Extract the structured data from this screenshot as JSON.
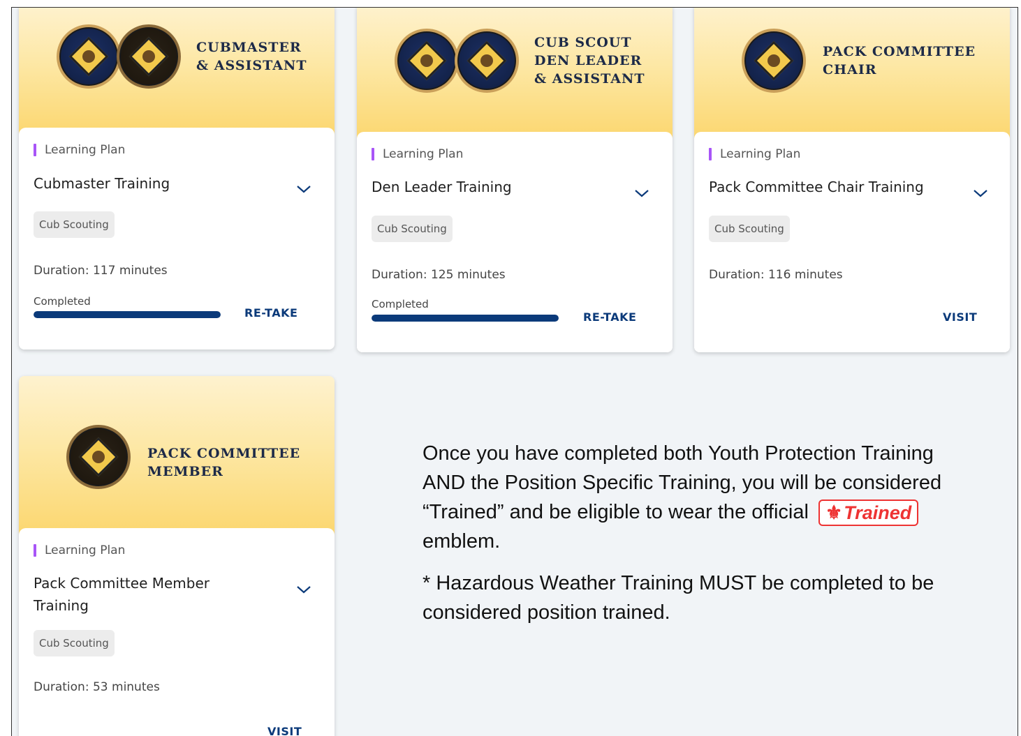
{
  "cards": [
    {
      "banner_line1": "CUBMASTER",
      "banner_line2": "& ASSISTANT",
      "banner_line3": "",
      "badge_icons": [
        "cubmaster-patch-icon",
        "assistant-cubmaster-patch-icon"
      ],
      "label": "Learning Plan",
      "title_line1": "Cubmaster Training",
      "title_line2": "",
      "tag": "Cub Scouting",
      "duration": "Duration: 117 minutes",
      "status": "Completed",
      "progress_percent": 100,
      "action": "RE-TAKE"
    },
    {
      "banner_line1": "CUB SCOUT",
      "banner_line2": "DEN LEADER",
      "banner_line3": "& ASSISTANT",
      "badge_icons": [
        "den-leader-patch-icon",
        "assistant-den-leader-patch-icon"
      ],
      "label": "Learning Plan",
      "title_line1": "Den Leader Training",
      "title_line2": "",
      "tag": "Cub Scouting",
      "duration": "Duration: 125 minutes",
      "status": "Completed",
      "progress_percent": 100,
      "action": "RE-TAKE"
    },
    {
      "banner_line1": "PACK COMMITTEE",
      "banner_line2": "CHAIR",
      "banner_line3": "",
      "badge_icons": [
        "pack-committee-chairman-patch-icon"
      ],
      "label": "Learning Plan",
      "title_line1": "Pack Committee Chair Training",
      "title_line2": "",
      "tag": "Cub Scouting",
      "duration": "Duration: 116 minutes",
      "status": "",
      "action": "VISIT"
    },
    {
      "banner_line1": "PACK COMMITTEE",
      "banner_line2": "MEMBER",
      "banner_line3": "",
      "badge_icons": [
        "pack-committee-patch-icon"
      ],
      "label": "Learning Plan",
      "title_line1": "Pack Committee Member",
      "title_line2": "Training",
      "tag": "Cub Scouting",
      "duration": "Duration: 53 minutes",
      "status": "",
      "action": "VISIT"
    }
  ],
  "info": {
    "paragraph_before": "Once you have completed both Youth Protection Training AND the Position Specific Training, you will be considered “Trained” and be eligible to wear the official",
    "emblem_text": "Trained",
    "paragraph_after": "emblem.",
    "note": "*  Hazardous Weather Training MUST be completed to be considered position trained."
  },
  "colors": {
    "accent_purple": "#a855f7",
    "progress_blue": "#0b3a7a",
    "trained_red": "#e33333",
    "banner_gold": "#fbd56a"
  }
}
